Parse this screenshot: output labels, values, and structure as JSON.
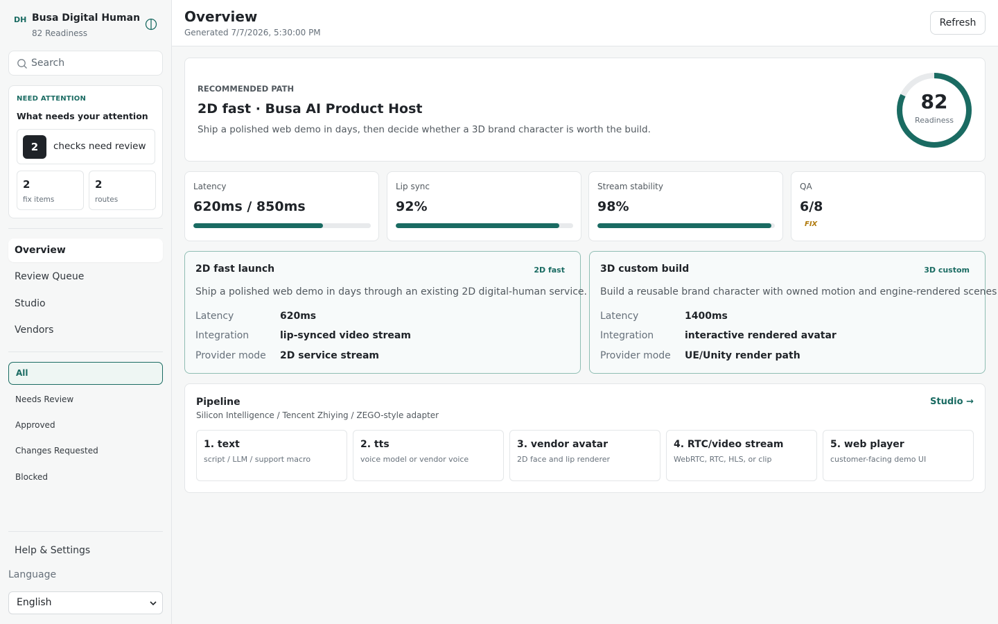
{
  "brand": {
    "logo": "DH",
    "name": "Busa Digital Human",
    "subtitle": "82 Readiness"
  },
  "search": {
    "placeholder": "Search"
  },
  "attention": {
    "kicker": "NEED ATTENTION",
    "title": "What needs your attention",
    "count": "2",
    "count_label": "checks need review",
    "fix_count": "2",
    "fix_label": "fix items",
    "routes_count": "2",
    "routes_label": "routes"
  },
  "nav": [
    "Overview",
    "Review Queue",
    "Studio",
    "Vendors"
  ],
  "filters": [
    "All",
    "Needs Review",
    "Approved",
    "Changes Requested",
    "Blocked"
  ],
  "help_label": "Help & Settings",
  "language": {
    "label": "Language",
    "selected": "English"
  },
  "header": {
    "title": "Overview",
    "generated": "Generated 7/7/2026, 5:30:00 PM",
    "refresh_label": "Refresh"
  },
  "hero": {
    "kicker": "RECOMMENDED PATH",
    "title": "2D fast · Busa AI Product Host",
    "description": "Ship a polished web demo in days, then decide whether a 3D brand character is worth the build.",
    "score": "82",
    "score_label": "Readiness",
    "score_value": 82
  },
  "metrics": [
    {
      "label": "Latency",
      "value": "620ms / 850ms",
      "progress": 0.73
    },
    {
      "label": "Lip sync",
      "value": "92%",
      "progress": 0.92
    },
    {
      "label": "Stream stability",
      "value": "98%",
      "progress": 0.98
    },
    {
      "label": "QA",
      "value": "6/8",
      "badge": "FIX"
    }
  ],
  "options": [
    {
      "title": "2D fast launch",
      "tag": "2D fast",
      "description": "Ship a polished web demo in days through an existing 2D digital-human service.",
      "rows": [
        {
          "key": "Latency",
          "value": "620ms"
        },
        {
          "key": "Integration",
          "value": "lip-synced video stream"
        },
        {
          "key": "Provider mode",
          "value": "2D service stream"
        }
      ]
    },
    {
      "title": "3D custom build",
      "tag": "3D custom",
      "description": "Build a reusable brand character with owned motion and engine-rendered scenes.",
      "rows": [
        {
          "key": "Latency",
          "value": "1400ms"
        },
        {
          "key": "Integration",
          "value": "interactive rendered avatar"
        },
        {
          "key": "Provider mode",
          "value": "UE/Unity render path"
        }
      ]
    }
  ],
  "pipeline": {
    "title": "Pipeline",
    "subtitle": "Silicon Intelligence / Tencent Zhiying / ZEGO-style adapter",
    "link": "Studio →",
    "steps": [
      {
        "title": "1. text",
        "desc": "script / LLM / support macro"
      },
      {
        "title": "2. tts",
        "desc": "voice model or vendor voice"
      },
      {
        "title": "3. vendor avatar",
        "desc": "2D face and lip renderer"
      },
      {
        "title": "4. RTC/video stream",
        "desc": "WebRTC, RTC, HLS, or clip"
      },
      {
        "title": "5. web player",
        "desc": "customer-facing demo UI"
      }
    ]
  },
  "colors": {
    "accent": "#1a6b62",
    "warning": "#b07a0c",
    "track": "#e8eaec"
  },
  "icons": {
    "collapse": "sidebar-toggle-icon",
    "search": "search-icon",
    "select": "chevron-down-icon"
  }
}
